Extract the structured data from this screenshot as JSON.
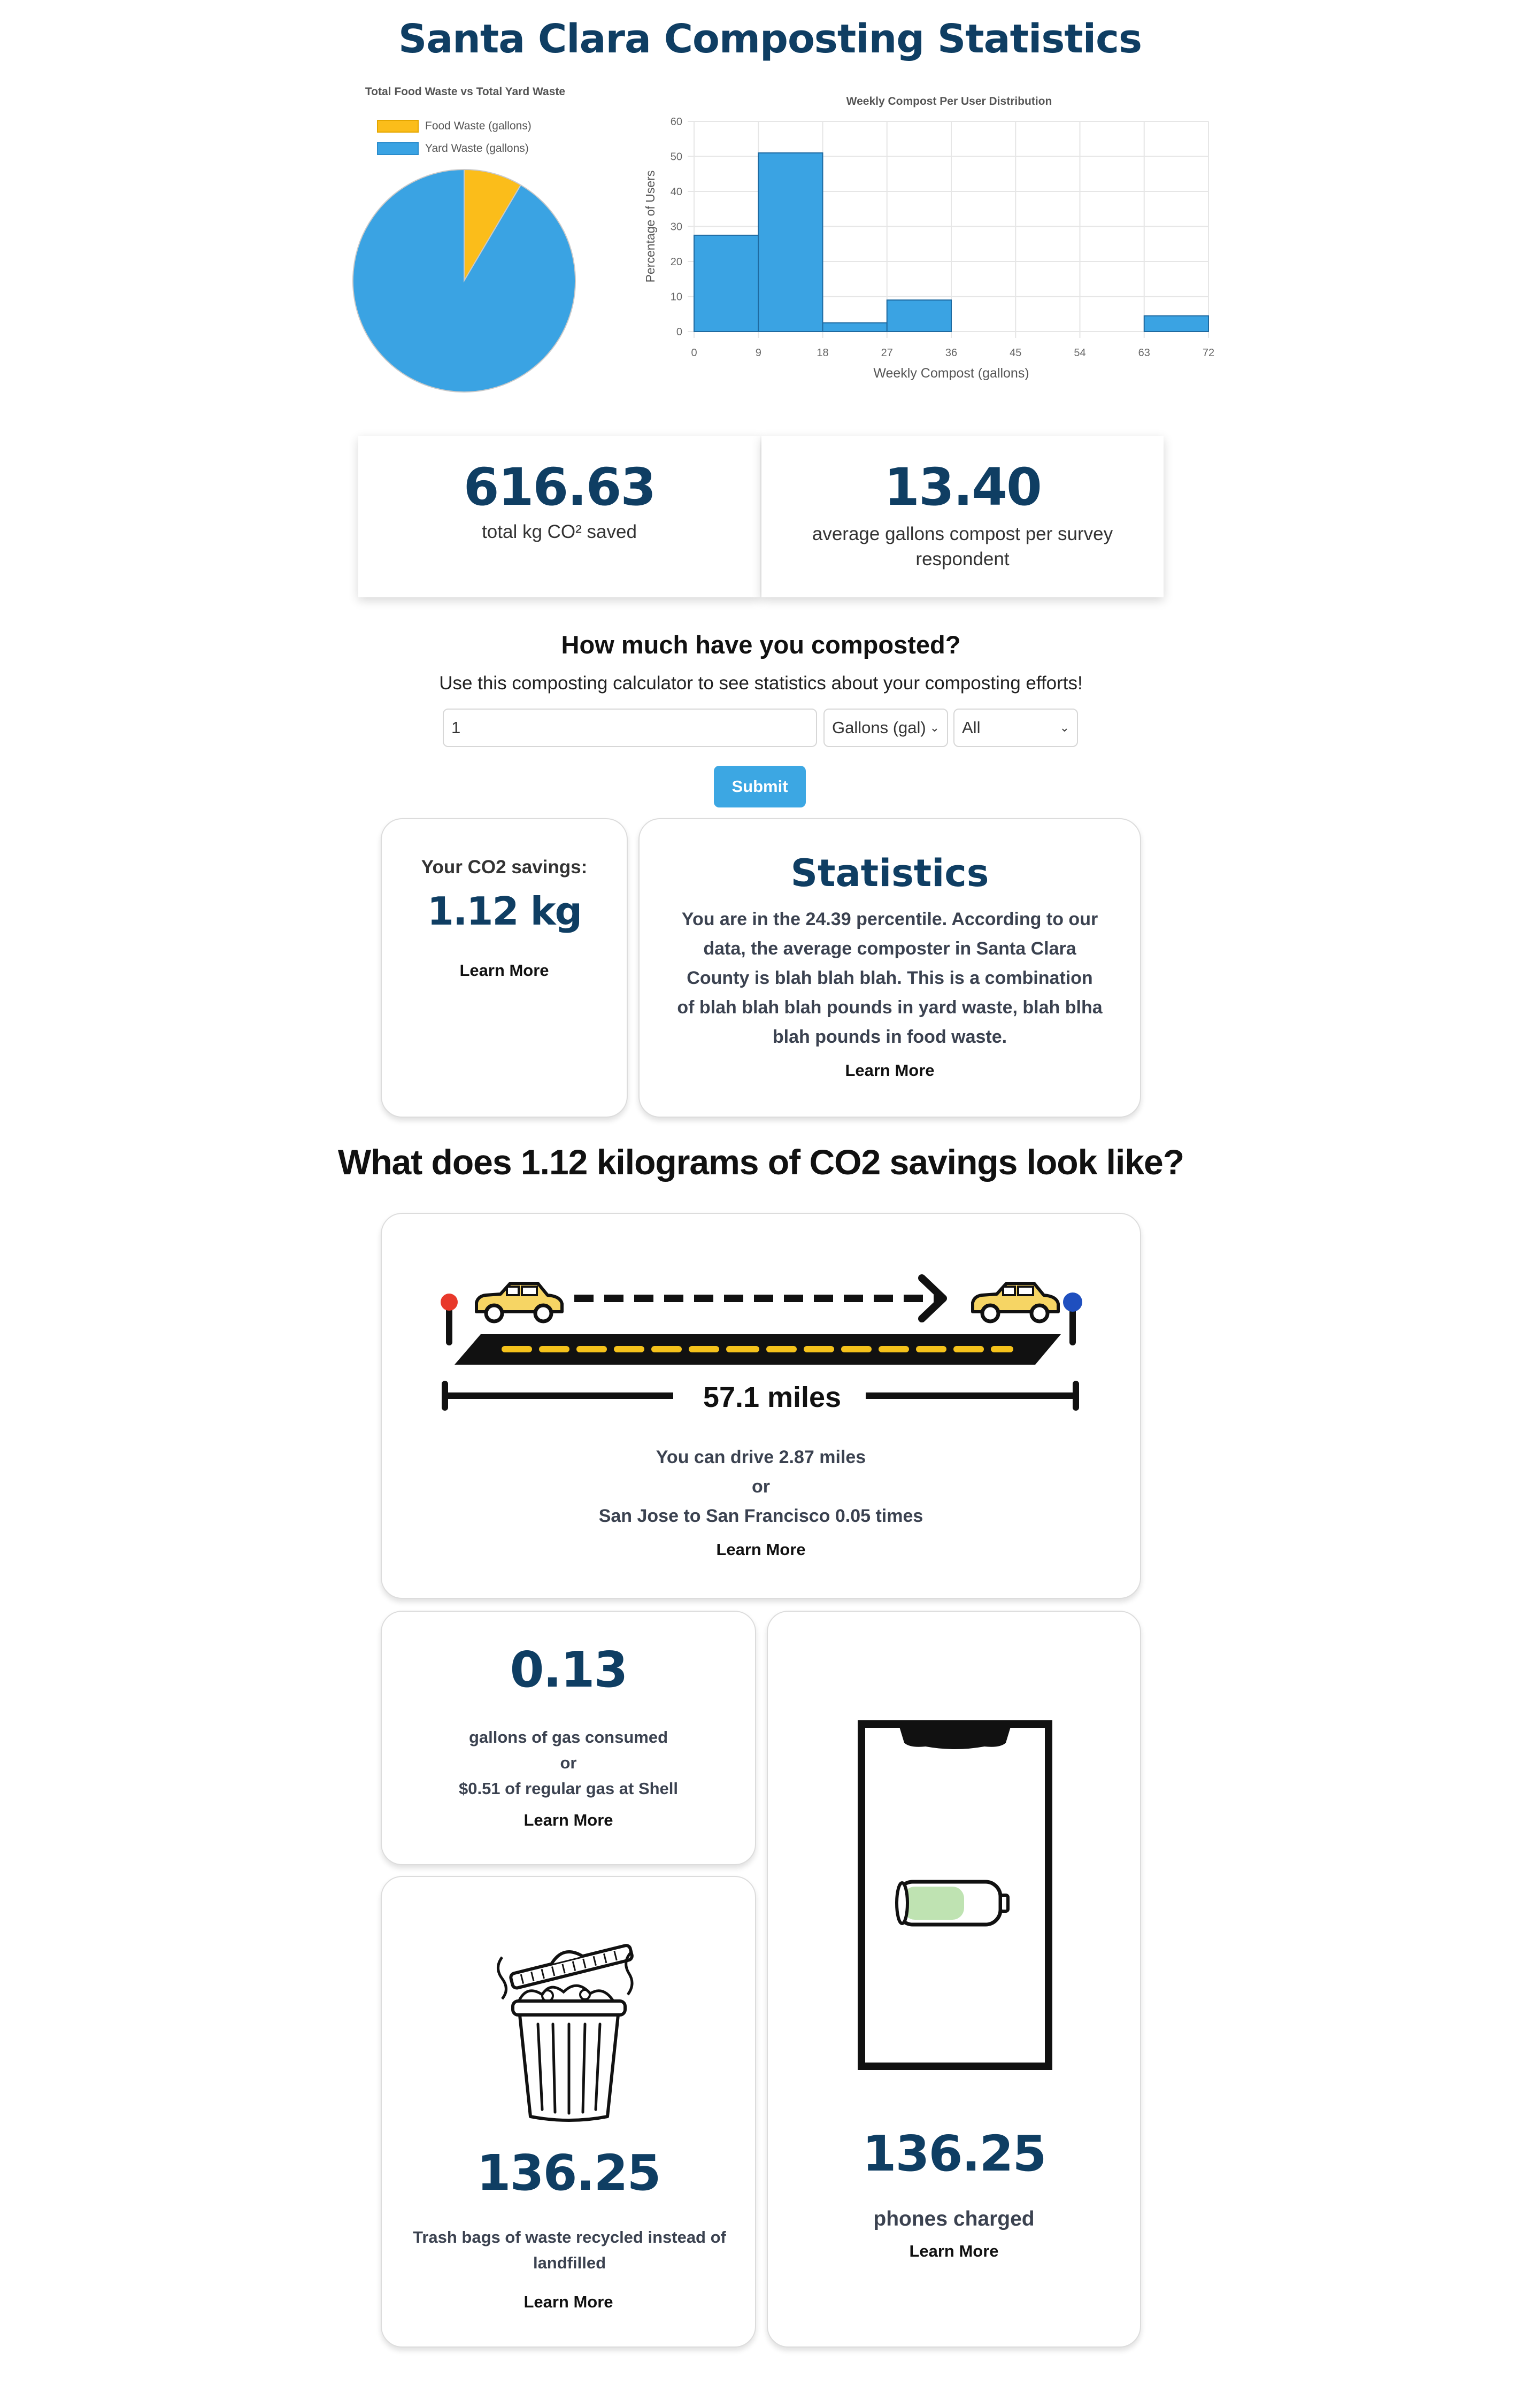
{
  "page": {
    "title": "Santa Clara Composting Statistics"
  },
  "charts": {
    "pie": {
      "title": "Total Food Waste vs Total Yard Waste",
      "legend": [
        "Food Waste (gallons)",
        "Yard Waste (gallons)"
      ],
      "colors": [
        "#fbbd1a",
        "#3aa3e3"
      ]
    },
    "hist": {
      "title": "Weekly Compost Per User Distribution",
      "xlabel": "Weekly Compost (gallons)",
      "ylabel": "Percentage of Users",
      "xticks": [
        "0",
        "9",
        "18",
        "27",
        "36",
        "45",
        "54",
        "63",
        "72"
      ],
      "yticks": [
        "0",
        "10",
        "20",
        "30",
        "40",
        "50",
        "60"
      ]
    }
  },
  "chart_data": [
    {
      "type": "pie",
      "title": "Total Food Waste vs Total Yard Waste",
      "labels": [
        "Food Waste (gallons)",
        "Yard Waste (gallons)"
      ],
      "values": [
        8.5,
        91.5
      ],
      "colors": [
        "#fbbd1a",
        "#3aa3e3"
      ],
      "legend_position": "top"
    },
    {
      "type": "bar",
      "title": "Weekly Compost Per User Distribution",
      "xlabel": "Weekly Compost (gallons)",
      "ylabel": "Percentage of Users",
      "bins": [
        [
          0,
          9
        ],
        [
          9,
          18
        ],
        [
          18,
          27
        ],
        [
          27,
          36
        ],
        [
          36,
          45
        ],
        [
          45,
          54
        ],
        [
          54,
          63
        ],
        [
          63,
          72
        ]
      ],
      "values": [
        27.5,
        51,
        2.5,
        9,
        0,
        0,
        0,
        4.5
      ],
      "xlim": [
        0,
        72
      ],
      "ylim": [
        0,
        60
      ],
      "grid": true,
      "color": "#3aa3e3"
    }
  ],
  "summary": {
    "co2_value": "616.63",
    "co2_label": "total kg CO² saved",
    "avg_value": "13.40",
    "avg_label": "average gallons compost per survey respondent"
  },
  "calculator": {
    "heading": "How much have you composted?",
    "description": "Use this composting calculator to see statistics about your composting efforts!",
    "amount_value": "1",
    "unit_selected": "Gallons (gal)",
    "type_selected": "All",
    "submit_label": "Submit"
  },
  "savings_card": {
    "label": "Your CO2 savings:",
    "value": "1.12 kg",
    "learn_more": "Learn More"
  },
  "statistics_card": {
    "title": "Statistics",
    "text": "You are in the 24.39 percentile. According to our data, the average composter in Santa Clara County is blah blah blah. This is a combination of blah blah blah pounds in yard waste, blah blha blah pounds in food waste.",
    "learn_more": "Learn More"
  },
  "visual_section": {
    "heading": "What does 1.12 kilograms of CO2 savings look like?"
  },
  "drive_card": {
    "distance_label": "57.1 miles",
    "line1": "You can drive 2.87 miles",
    "line2": "or",
    "line3": "San Jose to San Francisco 0.05 times",
    "learn_more": "Learn More"
  },
  "gas_card": {
    "value": "0.13",
    "line1": "gallons of gas consumed",
    "line2": "or",
    "line3": "$0.51 of regular gas at Shell",
    "learn_more": "Learn More"
  },
  "trash_card": {
    "value": "136.25",
    "text": "Trash bags of waste recycled instead of landfilled",
    "learn_more": "Learn More"
  },
  "phone_card": {
    "value": "136.25",
    "text": "phones charged",
    "learn_more": "Learn More"
  }
}
